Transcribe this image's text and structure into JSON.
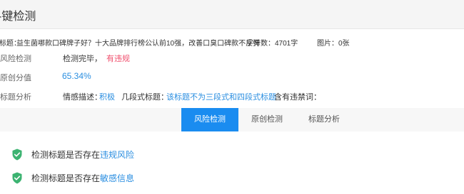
{
  "header": {
    "title": "-键检测"
  },
  "meta": {
    "title_label": "标题：",
    "title_value": "益生菌哪款口碑牌子好？十大品牌排行榜公认前10强，改善口臭口碑款不反弹",
    "wordcount_label": "字符数：",
    "wordcount_value": "4701字",
    "images_label": "图片：",
    "images_value": "0张"
  },
  "risk": {
    "label": "风险检测",
    "status": "检测完毕，",
    "result": "有违规"
  },
  "originality": {
    "label": "原创分值",
    "value": "65.34%"
  },
  "analysis": {
    "label": "标题分析",
    "sentiment_label": "情感描述：",
    "sentiment_value": "积极",
    "structure_label": "几段式标题：",
    "structure_value": "该标题不为三段式和四段式标题",
    "banned_label": "含有违禁词："
  },
  "tabs": [
    {
      "label": "风险检测",
      "active": true
    },
    {
      "label": "原创检测",
      "active": false
    },
    {
      "label": "标题分析",
      "active": false
    }
  ],
  "checks": [
    {
      "prefix": "检测标题是否存在",
      "link": "违规风险"
    },
    {
      "prefix": "检测标题是否存在",
      "link": "敏感信息"
    }
  ],
  "colors": {
    "accent": "#1a8cf0",
    "link": "#2a8ee0",
    "danger": "#f0506e",
    "success": "#3cb371"
  }
}
